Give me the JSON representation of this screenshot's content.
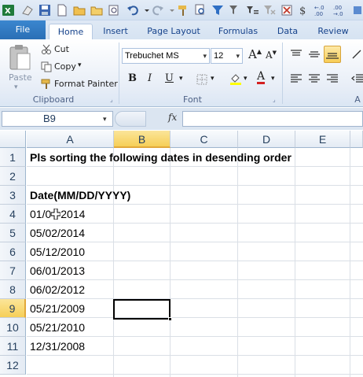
{
  "tabs": [
    "File",
    "Home",
    "Insert",
    "Page Layout",
    "Formulas",
    "Data",
    "Review"
  ],
  "active_tab": "Home",
  "clipboard": {
    "paste_label": "Paste",
    "cut_label": "Cut",
    "copy_label": "Copy",
    "format_painter_label": "Format Painter",
    "group_label": "Clipboard"
  },
  "font": {
    "name": "Trebuchet MS",
    "size": "12",
    "bold": "B",
    "italic": "I",
    "underline": "U",
    "grow": "A",
    "shrink": "A",
    "font_color_letter": "A",
    "group_label": "Font"
  },
  "alignment": {
    "group_label": "A"
  },
  "formula_bar": {
    "name_box": "B9",
    "fx": "fx",
    "formula": ""
  },
  "columns": [
    "A",
    "B",
    "C",
    "D",
    "E"
  ],
  "selected_column": "B",
  "rows": [
    "1",
    "2",
    "3",
    "4",
    "5",
    "6",
    "7",
    "8",
    "9",
    "10",
    "11",
    "12"
  ],
  "selected_row": "9",
  "cells": {
    "a1": "Pls sorting the following dates in desending order",
    "a3": "Date(MM/DD/YYYY)",
    "a4": "01/0",
    "a4_tail": "2014",
    "a5": "05/02/2014",
    "a6": "05/12/2010",
    "a7": "06/01/2013",
    "a8": "06/02/2012",
    "a9": "05/21/2009",
    "a10": "05/21/2010",
    "a11": "12/31/2008"
  },
  "colors": {
    "accent": "#2a6fb5",
    "selected_header": "#f6cf57",
    "ribbon_bg": "#dbe6f4"
  }
}
